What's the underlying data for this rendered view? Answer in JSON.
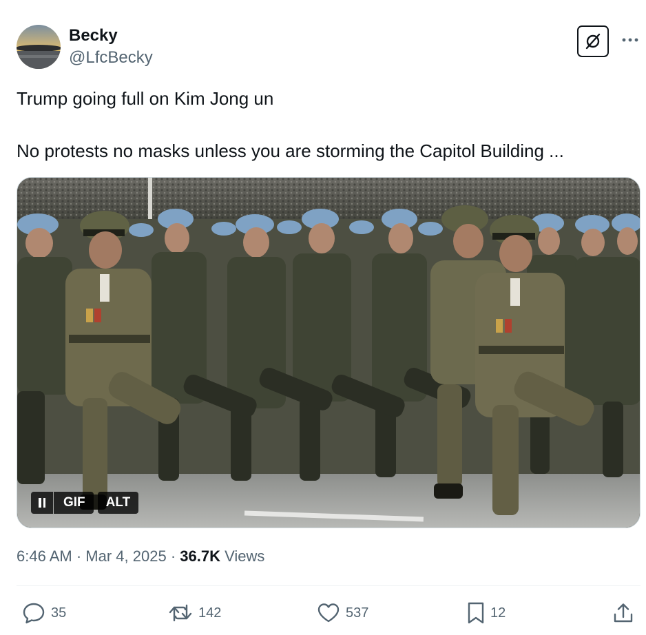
{
  "author": {
    "name": "Becky",
    "handle": "@LfcBecky"
  },
  "tweet": {
    "text": "Trump going full on Kim Jong un\n\nNo protests no masks unless you are storming the Capitol Building ..."
  },
  "media": {
    "gif_label": "GIF",
    "alt_label": "ALT"
  },
  "meta": {
    "time": "6:46 AM",
    "separator": "·",
    "date": "Mar 4, 2025",
    "views_count": "36.7K",
    "views_label": "Views"
  },
  "actions": {
    "replies": "35",
    "reposts": "142",
    "likes": "537",
    "bookmarks": "12"
  },
  "icons": {
    "more": "more-horizontal-icon",
    "grok": "grok-icon",
    "reply": "reply-icon",
    "repost": "repost-icon",
    "like": "heart-icon",
    "bookmark": "bookmark-icon",
    "share": "share-icon"
  },
  "colors": {
    "text_primary": "#0f1419",
    "text_secondary": "#536471",
    "divider": "#eff3f4"
  }
}
